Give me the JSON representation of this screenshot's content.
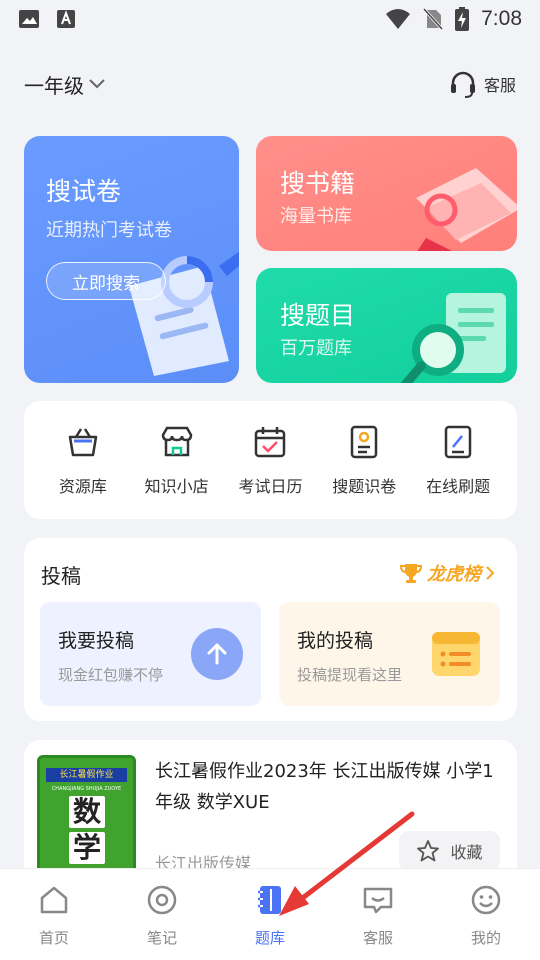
{
  "status_bar": {
    "time": "7:08"
  },
  "header": {
    "grade": "一年级",
    "service_label": "客服"
  },
  "cards": {
    "paper": {
      "title": "搜试卷",
      "subtitle": "近期热门考试卷",
      "button": "立即搜索",
      "color": "#5c8ef8"
    },
    "books": {
      "title": "搜书籍",
      "subtitle": "海量书库",
      "color": "#ff7f7a"
    },
    "questions": {
      "title": "搜题目",
      "subtitle": "百万题库",
      "color": "#12cf9c"
    }
  },
  "tools": [
    {
      "label": "资源库",
      "icon": "basket-icon"
    },
    {
      "label": "知识小店",
      "icon": "store-icon"
    },
    {
      "label": "考试日历",
      "icon": "calendar-icon"
    },
    {
      "label": "搜题识卷",
      "icon": "scan-doc-icon"
    },
    {
      "label": "在线刷题",
      "icon": "edit-doc-icon"
    }
  ],
  "submit": {
    "title": "投稿",
    "rank_label": "龙虎榜",
    "my_submit": {
      "title": "我要投稿",
      "desc": "现金红包赚不停"
    },
    "my_posts": {
      "title": "我的投稿",
      "desc": "投稿提现看这里"
    }
  },
  "book": {
    "title": "长江暑假作业2023年 长江出版传媒 小学1年级 数学XUE",
    "publisher": "长江出版传媒",
    "fav_label": "收藏",
    "cover_banner": "长江暑假作业",
    "cover_pinyin": "CHANGJIANG SHUJIA ZUOYE",
    "cover_chars": [
      "数",
      "学"
    ]
  },
  "nav": [
    {
      "label": "首页",
      "icon": "home-icon",
      "active": false
    },
    {
      "label": "笔记",
      "icon": "notes-icon",
      "active": false
    },
    {
      "label": "题库",
      "icon": "question-bank-icon",
      "active": true
    },
    {
      "label": "客服",
      "icon": "chat-icon",
      "active": false
    },
    {
      "label": "我的",
      "icon": "profile-icon",
      "active": false
    }
  ],
  "colors": {
    "accent": "#4a73f5",
    "rank": "#f5a623",
    "annotation_arrow": "#e53935"
  }
}
